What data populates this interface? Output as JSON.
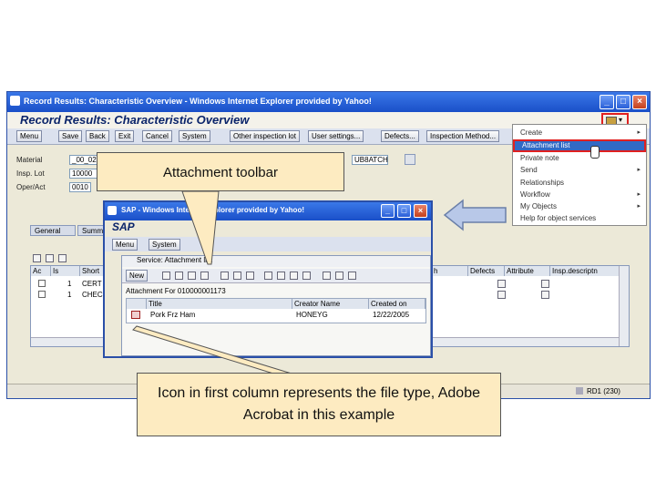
{
  "ie": {
    "title": "Record Results: Characteristic Overview - Windows Internet Explorer provided by Yahoo!",
    "page_title": "Record Results: Characteristic Overview",
    "window_buttons": [
      "_",
      "□",
      "×"
    ]
  },
  "toolbar": {
    "buttons": [
      "Menu",
      "Save",
      "Back",
      "Exit",
      "Cancel",
      "System",
      "Other inspection lot",
      "User settings...",
      "Defects...",
      "Inspection Method..."
    ]
  },
  "header": {
    "material_label": "Material",
    "material_value": "_00_026",
    "insp_lot_label": "Insp. Lot",
    "insp_lot_value": "10000",
    "oper_label": "Oper/Act",
    "oper_value": "0010",
    "batch_value": "UB8ATCH"
  },
  "tabs": [
    "General",
    "Summ"
  ],
  "grid": {
    "columns": [
      "Ac",
      "Is",
      "Short",
      "h",
      "Defects",
      "Attribute",
      "Insp.descriptn"
    ],
    "rows": [
      {
        "num": "1",
        "text": "CERT"
      },
      {
        "num": "1",
        "text": "CHEC"
      }
    ]
  },
  "status_bar": {
    "text": "RD1 (230)"
  },
  "context_menu": {
    "items": [
      {
        "label": "Create",
        "arrow": "▸"
      },
      {
        "label": "Attachment list",
        "arrow": ""
      },
      {
        "label": "Private note",
        "arrow": ""
      },
      {
        "label": "Send",
        "arrow": "▸"
      },
      {
        "label": "Relationships",
        "arrow": ""
      },
      {
        "label": "Workflow",
        "arrow": "▸"
      },
      {
        "label": "My Objects",
        "arrow": "▸"
      },
      {
        "label": "Help for object services",
        "arrow": ""
      }
    ]
  },
  "popup": {
    "title": "SAP - Windows Internet Explorer provided by Yahoo!",
    "sap_label": "SAP",
    "menu_buttons": [
      "Menu",
      "System"
    ],
    "service_title": "Service: Attachment list",
    "new_label": "New",
    "attachment_for": "Attachment For 010000001173",
    "columns": [
      "Title",
      "Creator Name",
      "Created on"
    ],
    "row": {
      "title": "Pork Frz Ham",
      "creator": "HONEYG",
      "created": "12/22/2005"
    }
  },
  "callouts": {
    "toolbar": "Attachment toolbar",
    "icon": "Icon in first column represents the file type, Adobe Acrobat in this example"
  },
  "colors": {
    "title_blue": "#1a4fc8",
    "highlight_red": "#e02020",
    "callout_fill": "#fdebc1",
    "selected_menu": "#316ac5"
  }
}
